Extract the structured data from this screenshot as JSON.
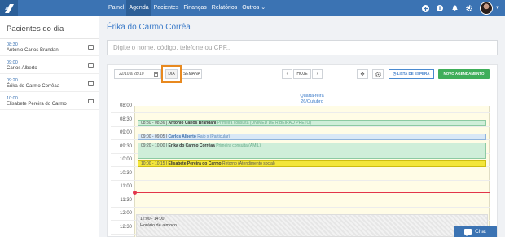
{
  "topbar": {
    "nav": [
      "Painel",
      "Agenda",
      "Pacientes",
      "Finanças",
      "Relatórios",
      "Outros"
    ],
    "active_nav": "Agenda",
    "outros_caret": "⌄"
  },
  "sidebar": {
    "title": "Pacientes do dia",
    "items": [
      {
        "time": "08:30",
        "name": "Antonio Carlos Brandani"
      },
      {
        "time": "09:00",
        "name": "Carlos Alberto"
      },
      {
        "time": "09:20",
        "name": "Érika do Carmo Corrêaa"
      },
      {
        "time": "10:00",
        "name": "Elisabete Pereira do Carmo"
      }
    ]
  },
  "main": {
    "title": "Érika do Carmo Corrêa",
    "search_placeholder": "Digite o nome, código, telefone ou CPF..."
  },
  "toolbar": {
    "date_range": "22/10 à 28/10",
    "dia": "DIA",
    "semana": "SEMANA",
    "prev": "‹",
    "hoje": "HOJE",
    "next": "›",
    "lista_espera": "LISTA DE ESPERA",
    "novo": "NOVO AGENDAMENTO",
    "icon_move": "move-icon",
    "icon_settings": "gear-icon"
  },
  "calendar": {
    "weekday": "Quarta-feira",
    "date": "26/Outubro",
    "hours": [
      "08:00",
      "08:30",
      "09:00",
      "09:30",
      "10:00",
      "10:30",
      "11:00",
      "11:30",
      "12:00",
      "12:30"
    ],
    "appointments": [
      {
        "time": "08:30 - 08:36",
        "name": "Antonio Carlos Brandani",
        "desc": "Primeira consulta (UNIMED DE RIBEIRÃO PRETO)",
        "color": "green"
      },
      {
        "time": "09:00 - 09:05",
        "name": "Carlos Alberto",
        "desc": "Raio x (Particular)",
        "color": "blue"
      },
      {
        "time": "09:20 - 10:00",
        "name": "Érika do Carmo Corrêaa",
        "desc": "Primeira consulta (AMIL)",
        "color": "green"
      },
      {
        "time": "10:00 - 10:15",
        "name": "Elisabete Pereira do Carmo",
        "desc": "Retorno (Atendimento social)",
        "color": "yellow"
      }
    ],
    "lunch_time": "12:00 - 14:00",
    "lunch_label": "Horário de almoço"
  },
  "chat": {
    "label": "Chat"
  }
}
